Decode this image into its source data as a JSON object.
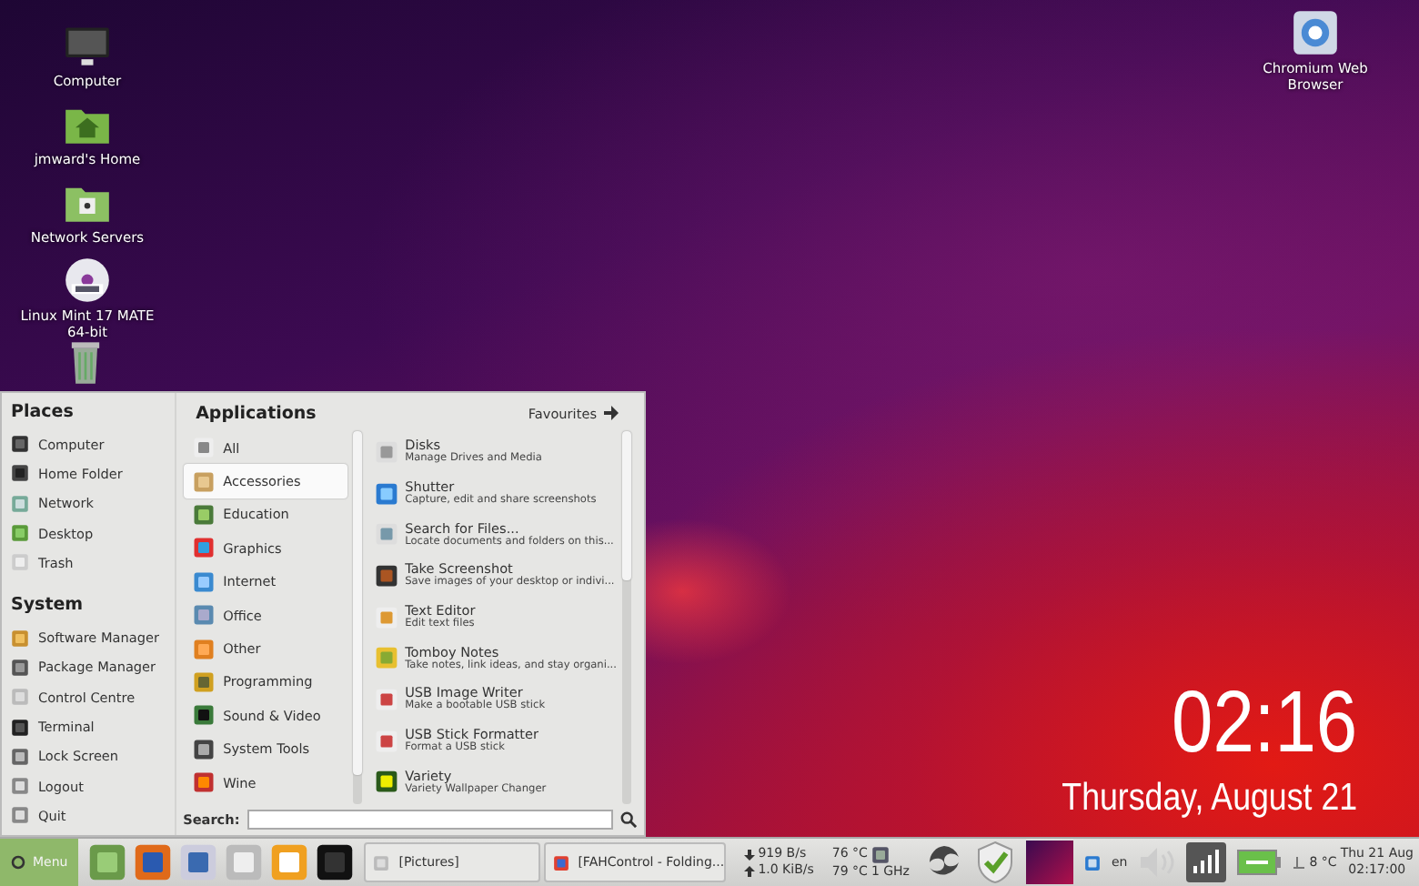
{
  "desktop_icons": [
    {
      "label": "Computer"
    },
    {
      "label": "jmward's Home"
    },
    {
      "label": "Network Servers"
    },
    {
      "label": "Linux Mint 17 MATE 64-bit"
    },
    {
      "label": "Chromium Web Browser"
    }
  ],
  "desktop_clock": {
    "time": "02:16",
    "date": "Thursday, August 21"
  },
  "menu": {
    "places_title": "Places",
    "places": [
      "Computer",
      "Home Folder",
      "Network",
      "Desktop",
      "Trash"
    ],
    "system_title": "System",
    "system": [
      "Software Manager",
      "Package Manager",
      "Control Centre",
      "Terminal",
      "Lock Screen",
      "Logout",
      "Quit"
    ],
    "applications_title": "Applications",
    "favourites_label": "Favourites",
    "categories": [
      {
        "label": "All",
        "selected": false
      },
      {
        "label": "Accessories",
        "selected": true
      },
      {
        "label": "Education",
        "selected": false
      },
      {
        "label": "Graphics",
        "selected": false
      },
      {
        "label": "Internet",
        "selected": false
      },
      {
        "label": "Office",
        "selected": false
      },
      {
        "label": "Other",
        "selected": false
      },
      {
        "label": "Programming",
        "selected": false
      },
      {
        "label": "Sound & Video",
        "selected": false
      },
      {
        "label": "System Tools",
        "selected": false
      },
      {
        "label": "Wine",
        "selected": false
      }
    ],
    "apps": [
      {
        "name": "Disks",
        "description": "Manage Drives and Media"
      },
      {
        "name": "Shutter",
        "description": "Capture, edit and share screenshots"
      },
      {
        "name": "Search for Files...",
        "description": "Locate documents and folders on this..."
      },
      {
        "name": "Take Screenshot",
        "description": "Save images of your desktop or indivi..."
      },
      {
        "name": "Text Editor",
        "description": "Edit text files"
      },
      {
        "name": "Tomboy Notes",
        "description": "Take notes, link ideas, and stay organi..."
      },
      {
        "name": "USB Image Writer",
        "description": "Make a bootable USB stick"
      },
      {
        "name": "USB Stick Formatter",
        "description": "Format a USB stick"
      },
      {
        "name": "Variety",
        "description": "Variety Wallpaper Changer"
      }
    ],
    "search_label": "Search:"
  },
  "panel": {
    "menu_label": "Menu",
    "windows": [
      {
        "title": "[Pictures]"
      },
      {
        "title": "[FAHControl - Folding..."
      }
    ],
    "net_down": "919 B/s",
    "net_up": "1.0 KiB/s",
    "temp_1": "76 °C",
    "temp_2": "79 °C",
    "cpu_freq": "1 GHz",
    "language": "en",
    "weather": "8 °C",
    "date": "Thu 21 Aug",
    "time": "02:17:00"
  }
}
